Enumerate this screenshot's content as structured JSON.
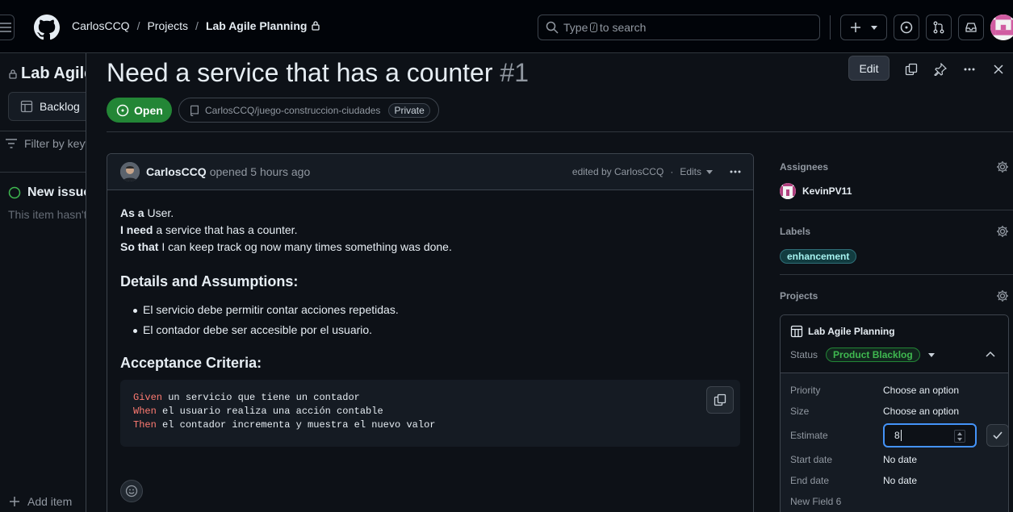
{
  "header": {
    "breadcrumb": {
      "owner": "CarlosCCQ",
      "section": "Projects",
      "project": "Lab Agile Planning"
    },
    "search": {
      "prefix": "Type",
      "key": "/",
      "suffix": "to search"
    }
  },
  "project_bg": {
    "title": "Lab Agile Planning",
    "tab_label": "Backlog",
    "filter_placeholder": "Filter by keyword",
    "new_item_title": "New issue",
    "new_item_desc": "This item hasn't been started",
    "add_item": "Add item"
  },
  "issue": {
    "title": "Need a service that has a counter",
    "number": "#1",
    "state": "Open",
    "repo": "CarlosCCQ/juego-construccion-ciudades",
    "visibility": "Private",
    "edit_label": "Edit",
    "comment": {
      "author": "CarlosCCQ",
      "action": "opened 5 hours ago",
      "edited_by": "edited by CarlosCCQ",
      "edits_label": "Edits",
      "story": [
        {
          "bold": "As a",
          "text": " User."
        },
        {
          "bold": "I need",
          "text": " a service that has a counter."
        },
        {
          "bold": "So that",
          "text": " I can keep track og now many times something was done."
        }
      ],
      "details_heading": "Details and Assumptions:",
      "details": [
        "El servicio debe permitir contar acciones repetidas.",
        "El contador debe ser accesible por el usuario."
      ],
      "acceptance_heading": "Acceptance Criteria:",
      "code": [
        {
          "kw": "Given",
          "text": " un servicio que tiene un contador"
        },
        {
          "kw": "When",
          "text": " el usuario realiza una acción contable"
        },
        {
          "kw": "Then",
          "text": " el contador incrementa y muestra el nuevo valor"
        }
      ]
    }
  },
  "sidebar": {
    "assignees_heading": "Assignees",
    "assignee": "KevinPV11",
    "labels_heading": "Labels",
    "label": "enhancement",
    "projects_heading": "Projects",
    "project": {
      "name": "Lab Agile Planning",
      "status_label": "Status",
      "status_value": "Product Blacklog",
      "fields": {
        "priority": {
          "label": "Priority",
          "value": "Choose an option"
        },
        "size": {
          "label": "Size",
          "value": "Choose an option"
        },
        "estimate": {
          "label": "Estimate",
          "value": "8"
        },
        "start": {
          "label": "Start date",
          "value": "No date"
        },
        "end": {
          "label": "End date",
          "value": "No date"
        },
        "new_field": {
          "label": "New Field 6",
          "value": ""
        }
      }
    }
  },
  "colors": {
    "open_green": "#238636",
    "status_green": "#3fb950",
    "label_teal": "#a7f3f0",
    "focus_blue": "#4493f8",
    "keyword_red": "#ff7b72"
  }
}
